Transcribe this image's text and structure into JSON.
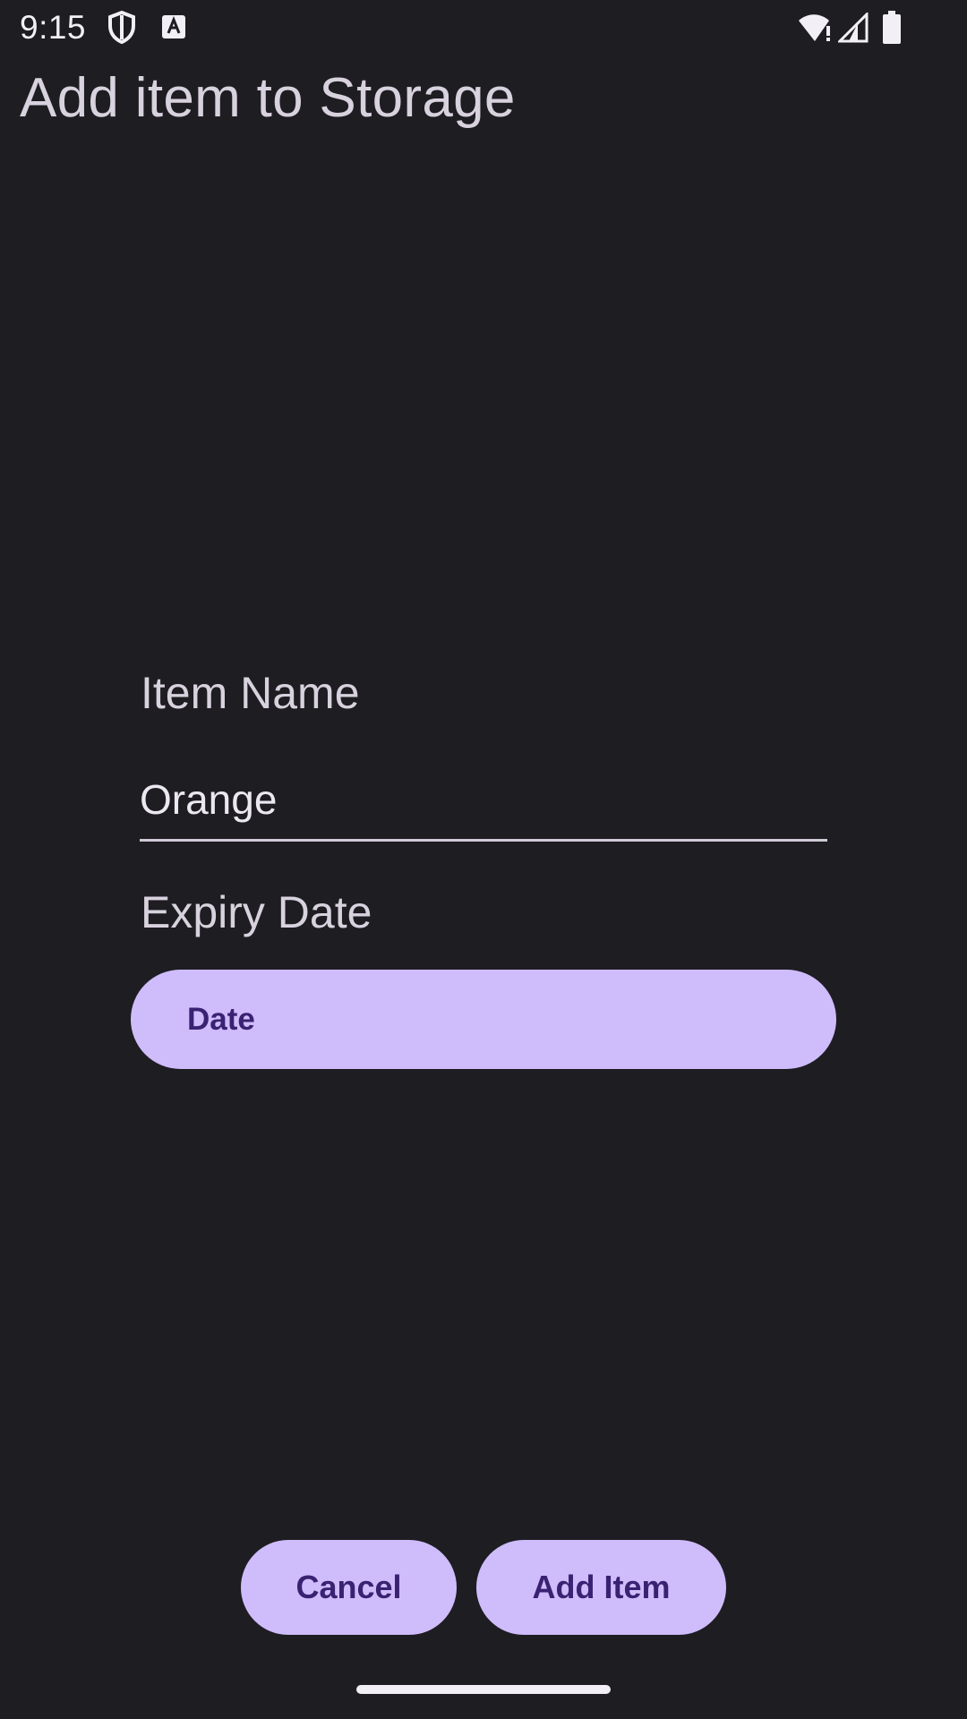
{
  "status_bar": {
    "time": "9:15",
    "icons": [
      "shield-icon",
      "text-a-icon",
      "wifi-alert-icon",
      "cell-signal-icon",
      "battery-icon"
    ]
  },
  "header": {
    "title": "Add item to Storage"
  },
  "form": {
    "item_name_label": "Item Name",
    "item_name_value": "Orange",
    "expiry_label": "Expiry Date",
    "date_button_label": "Date"
  },
  "actions": {
    "cancel_label": "Cancel",
    "add_label": "Add Item"
  },
  "colors": {
    "background": "#1e1d22",
    "button_fill": "#cfbcfb",
    "button_text": "#3a2272",
    "label_text": "#d8d2de"
  }
}
